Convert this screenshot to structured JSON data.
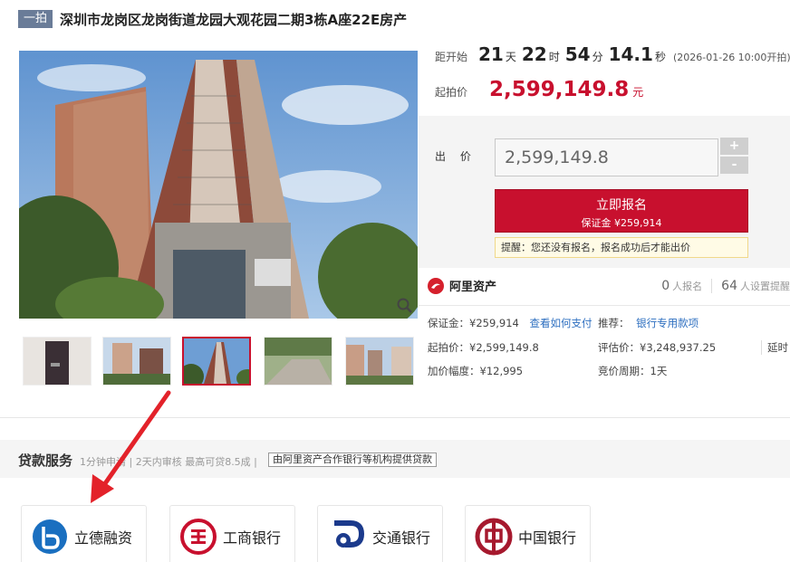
{
  "header": {
    "badge": "一拍",
    "title": "深圳市龙岗区龙岗街道龙园大观花园二期3栋A座22E房产"
  },
  "countdown": {
    "label": "距开始",
    "days": "21",
    "days_unit": "天",
    "hours": "22",
    "hours_unit": "时",
    "minutes": "54",
    "minutes_unit": "分",
    "seconds": "14.1",
    "seconds_unit": "秒",
    "start_time": "(2026-01-26 10:00开拍)"
  },
  "start_price": {
    "label": "起拍价",
    "value": "2,599,149.8",
    "unit": "元"
  },
  "bid": {
    "label": "出 价",
    "input_value": "2,599,149.8",
    "plus": "+",
    "minus": "-",
    "register_label": "立即报名",
    "deposit_label": "保证金 ¥259,914",
    "tip": "提醒：您还没有报名，报名成功后才能出价"
  },
  "platform": {
    "name": "阿里资产",
    "registered_count": "0",
    "registered_label": "人报名",
    "reminders_count": "64",
    "reminders_label": "人设置提醒"
  },
  "details": {
    "deposit": "保证金：¥259,914",
    "how_to_pay": "查看如何支付",
    "recommend": "推荐：",
    "bank_payment": "银行专用款项",
    "start_price": "起拍价：¥2,599,149.8",
    "appraisal": "评估价：¥3,248,937.25",
    "extension": "延时",
    "increment": "加价幅度：¥12,995",
    "bid_cycle": "竞价周期：1天"
  },
  "loan": {
    "title": "贷款服务",
    "desc": "1分钟申请 | 2天内审核 最高可贷8.5成 |",
    "tag": "由阿里资产合作银行等机构提供贷款",
    "banks": [
      "立德融资",
      "工商银行",
      "交通银行",
      "中国银行"
    ]
  },
  "colors": {
    "accent_red": "#c8102e",
    "badge_blue": "#6a7c98",
    "link_blue": "#2e6fc0"
  },
  "icons": [
    "zoom-icon",
    "alibaba-logo-icon",
    "lide-logo-icon",
    "icbc-logo-icon",
    "bocom-logo-icon",
    "boc-logo-icon",
    "arrow-annotation"
  ]
}
